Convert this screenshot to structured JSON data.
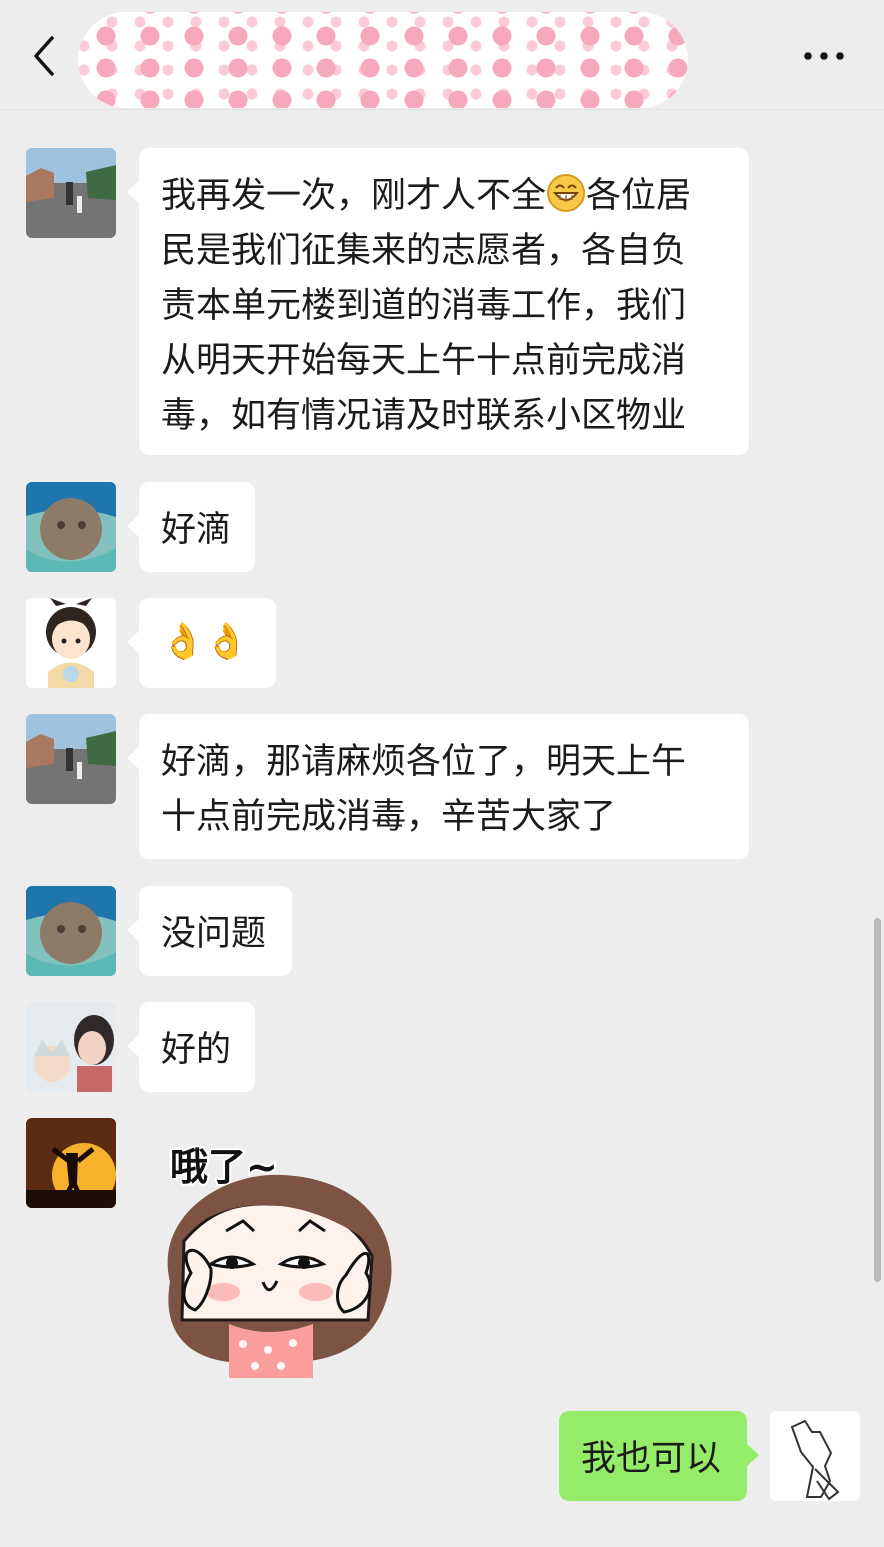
{
  "header": {
    "back_icon": "chevron-left-icon",
    "more_icon": "ellipsis-icon"
  },
  "messages": [
    {
      "lines": [
        "我再发一次，刚才人不全",
        "各位居",
        "民是我们征集来的志愿者，各自负",
        "责本单元楼到道的消毒工作，我们",
        "从明天开始每天上午十点前完成消",
        "毒，如有情况请及时联系小区物业"
      ]
    },
    {
      "text": "好滴"
    },
    {
      "text": "👌👌"
    },
    {
      "lines": [
        "好滴，那请麻烦各位了，明天上午",
        "十点前完成消毒，辛苦大家了"
      ]
    },
    {
      "text": "没问题"
    },
    {
      "text": "好的"
    },
    {
      "sticker_text": "哦了~"
    },
    {
      "text": "我也可以"
    }
  ],
  "colors": {
    "background": "#ededed",
    "bubble": "#ffffff",
    "own_bubble": "#95ec69",
    "text": "#1b1b1b"
  }
}
